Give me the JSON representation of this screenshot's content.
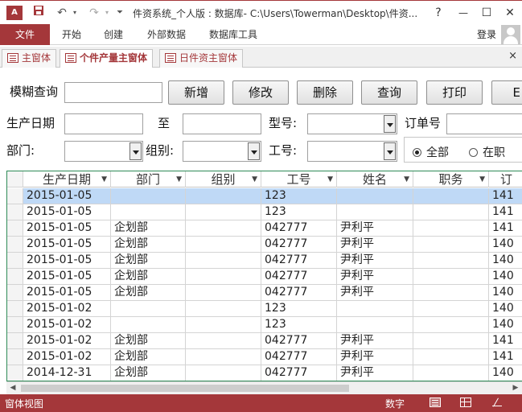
{
  "window": {
    "title": "件资系统_个人版 : 数据库- C:\\Users\\Towerman\\Desktop\\件资...",
    "app_icon": "A",
    "help_label": "?",
    "minimize_label": "—",
    "restore_label": "☐",
    "close_label": "✕"
  },
  "ribbon": {
    "file": "文件",
    "tabs": [
      "开始",
      "创建",
      "外部数据",
      "数据库工具"
    ],
    "login": "登录"
  },
  "doc_tabs": [
    "主窗体",
    "个件产量主窗体",
    "日件资主窗体"
  ],
  "doc_close": "×",
  "form": {
    "fuzzy_label": "模糊查询",
    "buttons": [
      "新增",
      "修改",
      "删除",
      "查询",
      "打印",
      "E"
    ],
    "date_label": "生产日期",
    "to_label": "至",
    "model_label": "型号:",
    "order_label": "订单号",
    "dept_label": "部门:",
    "group_label": "组别:",
    "empno_label": "工号:",
    "radio_all": "全部",
    "radio_active": "在职"
  },
  "grid": {
    "columns": [
      "生产日期",
      "部门",
      "组别",
      "工号",
      "姓名",
      "职务",
      "订"
    ],
    "rows": [
      [
        "2015-01-05",
        "",
        "",
        "123",
        "",
        "",
        "141"
      ],
      [
        "2015-01-05",
        "",
        "",
        "123",
        "",
        "",
        "141"
      ],
      [
        "2015-01-05",
        "企划部",
        "",
        "042777",
        "尹利平",
        "",
        "141"
      ],
      [
        "2015-01-05",
        "企划部",
        "",
        "042777",
        "尹利平",
        "",
        "140"
      ],
      [
        "2015-01-05",
        "企划部",
        "",
        "042777",
        "尹利平",
        "",
        "140"
      ],
      [
        "2015-01-05",
        "企划部",
        "",
        "042777",
        "尹利平",
        "",
        "140"
      ],
      [
        "2015-01-05",
        "企划部",
        "",
        "042777",
        "尹利平",
        "",
        "140"
      ],
      [
        "2015-01-02",
        "",
        "",
        "123",
        "",
        "",
        "140"
      ],
      [
        "2015-01-02",
        "",
        "",
        "123",
        "",
        "",
        "140"
      ],
      [
        "2015-01-02",
        "企划部",
        "",
        "042777",
        "尹利平",
        "",
        "141"
      ],
      [
        "2015-01-02",
        "企划部",
        "",
        "042777",
        "尹利平",
        "",
        "141"
      ],
      [
        "2014-12-31",
        "企划部",
        "",
        "042777",
        "尹利平",
        "",
        "140"
      ]
    ]
  },
  "status": {
    "view": "窗体视图",
    "num": "数字"
  }
}
